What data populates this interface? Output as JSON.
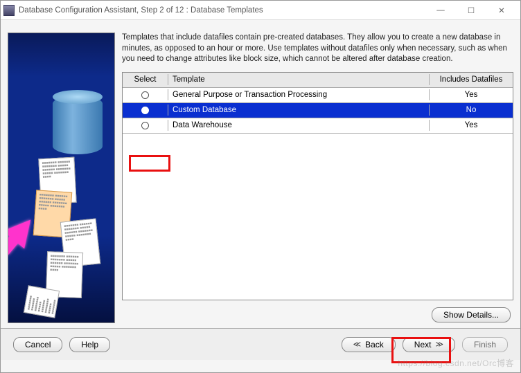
{
  "window": {
    "title": "Database Configuration Assistant, Step 2 of 12 : Database Templates"
  },
  "description": "Templates that include datafiles contain pre-created databases. They allow you to create a new database in minutes, as opposed to an hour or more. Use templates without datafiles only when necessary, such as when you need to change attributes like block size, which cannot be altered after database creation.",
  "table": {
    "headers": {
      "select": "Select",
      "template": "Template",
      "includes": "Includes Datafiles"
    },
    "rows": [
      {
        "template": "General Purpose or Transaction Processing",
        "includes": "Yes",
        "selected": false
      },
      {
        "template": "Custom Database",
        "includes": "No",
        "selected": true
      },
      {
        "template": "Data Warehouse",
        "includes": "Yes",
        "selected": false
      }
    ]
  },
  "buttons": {
    "show_details": "Show Details...",
    "cancel": "Cancel",
    "help": "Help",
    "back": "Back",
    "next": "Next",
    "finish": "Finish"
  },
  "glyphs": {
    "back": "≪",
    "next": "≫"
  },
  "watermark": "https://blog.csdn.net/Orc博客"
}
